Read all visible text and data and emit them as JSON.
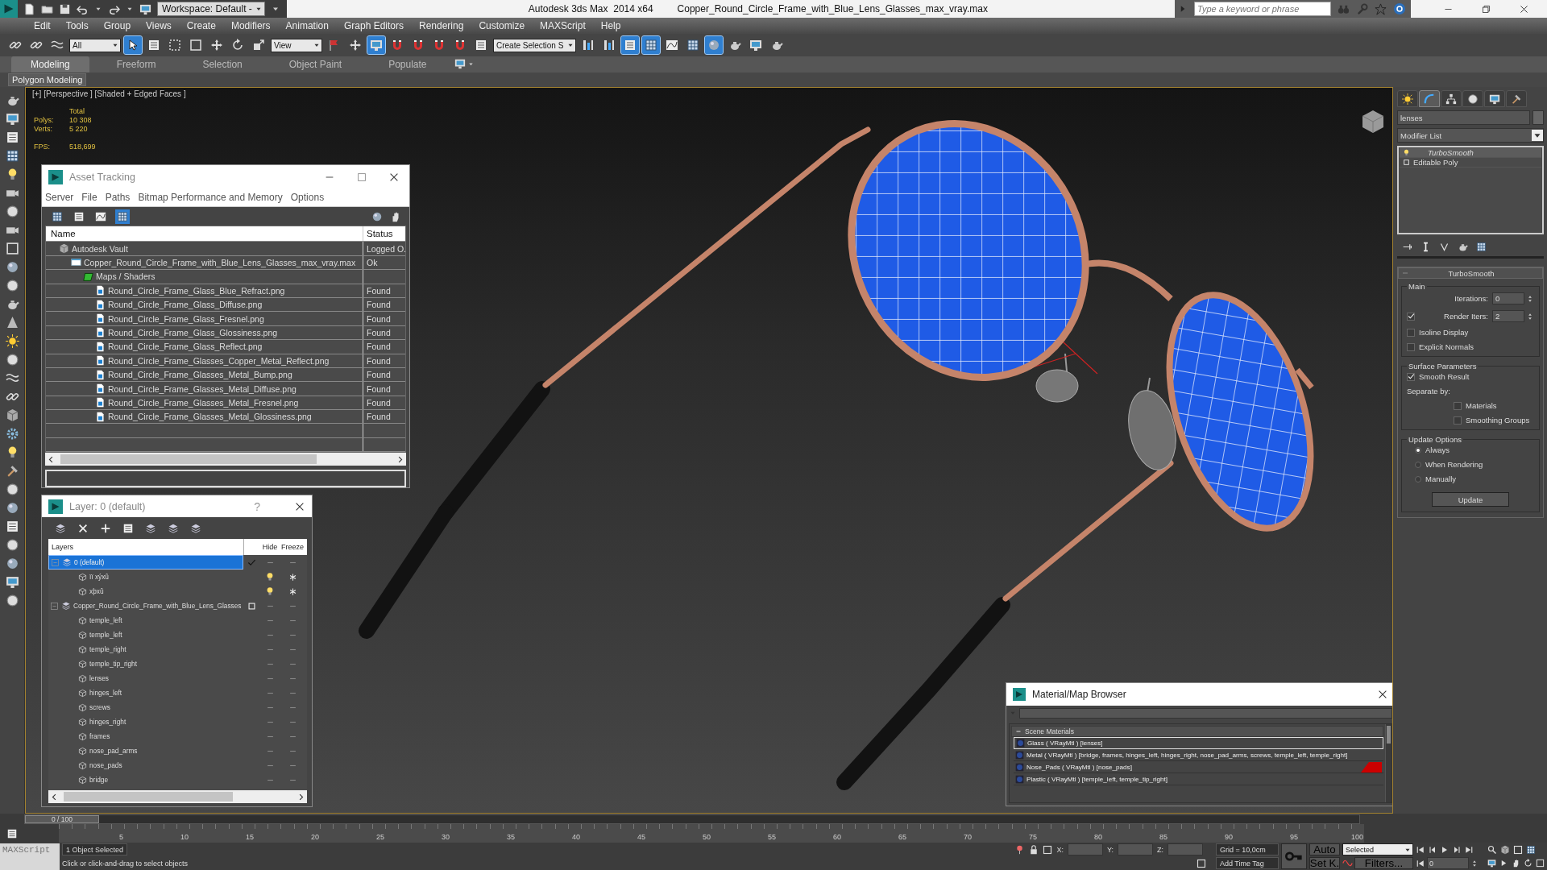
{
  "title_bar": {
    "workspace": "Workspace: Default -",
    "app_title": "Autodesk 3ds Max  2014 x64",
    "file_name": "Copper_Round_Circle_Frame_with_Blue_Lens_Glasses_max_vray.max",
    "search": {
      "placeholder": "Type a keyword or phrase"
    }
  },
  "menu": [
    "Edit",
    "Tools",
    "Group",
    "Views",
    "Create",
    "Modifiers",
    "Animation",
    "Graph Editors",
    "Rendering",
    "Customize",
    "MAXScript",
    "Help"
  ],
  "main_toolbar": [
    {
      "kind": "icon",
      "selected": false
    },
    {
      "kind": "icon",
      "selected": false
    },
    {
      "kind": "icon",
      "selected": false
    },
    {
      "kind": "dropdown",
      "value": "All"
    },
    {
      "kind": "icon",
      "selected": true
    },
    {
      "kind": "icon",
      "selected": false
    },
    {
      "kind": "icon",
      "selected": false
    },
    {
      "kind": "icon",
      "selected": false
    },
    {
      "kind": "icon",
      "selected": false
    },
    {
      "kind": "icon",
      "selected": false
    },
    {
      "kind": "icon",
      "selected": false
    },
    {
      "kind": "dropdown",
      "value": "View"
    },
    {
      "kind": "icon",
      "selected": false
    },
    {
      "kind": "icon",
      "selected": false
    },
    {
      "kind": "icon",
      "selected": true
    },
    {
      "kind": "icon",
      "selected": false
    },
    {
      "kind": "icon",
      "selected": false
    },
    {
      "kind": "icon",
      "selected": false
    },
    {
      "kind": "icon",
      "selected": false
    },
    {
      "kind": "icon",
      "selected": false
    },
    {
      "kind": "dropdown",
      "value": "Create Selection S"
    },
    {
      "kind": "icon",
      "selected": false
    },
    {
      "kind": "icon",
      "selected": false
    },
    {
      "kind": "icon",
      "selected": true
    },
    {
      "kind": "icon",
      "selected": true
    },
    {
      "kind": "icon",
      "selected": false
    },
    {
      "kind": "icon",
      "selected": false
    },
    {
      "kind": "icon",
      "selected": true
    },
    {
      "kind": "icon",
      "selected": false
    },
    {
      "kind": "icon",
      "selected": false
    },
    {
      "kind": "icon",
      "selected": false
    }
  ],
  "ribbon": {
    "tabs": [
      {
        "label": "Modeling",
        "selected": true
      },
      {
        "label": "Freeform",
        "selected": false
      },
      {
        "label": "Selection",
        "selected": false
      },
      {
        "label": "Object Paint",
        "selected": false
      },
      {
        "label": "Populate",
        "selected": false
      }
    ],
    "panel": "Polygon Modeling"
  },
  "viewport": {
    "label": "[+] [Perspective ] [Shaded + Edged Faces ]",
    "stats": {
      "heading": "Total",
      "rows": [
        {
          "label": "Polys:",
          "value": "10 308"
        },
        {
          "label": "Verts:",
          "value": "5 220"
        }
      ]
    },
    "fps": {
      "label": "FPS:",
      "value": "518,699"
    }
  },
  "asset_tracking": {
    "title": "Asset Tracking",
    "menu": [
      "Server",
      "File",
      "Paths",
      "Bitmap Performance and Memory",
      "Options"
    ],
    "toolbar": [
      {
        "selected": false
      },
      {
        "selected": false
      },
      {
        "selected": false
      },
      {
        "selected": true
      }
    ],
    "columns": [
      "Name",
      "Status"
    ],
    "rows": [
      {
        "name": "Autodesk Vault",
        "kind": "vault",
        "status": "Logged O.",
        "children": [
          {
            "name": "Copper_Round_Circle_Frame_with_Blue_Lens_Glasses_max_vray.max",
            "kind": "scene",
            "status": "Ok",
            "children": [
              {
                "name": "Maps / Shaders",
                "kind": "folder",
                "children": [
                  {
                    "name": "Round_Circle_Frame_Glass_Blue_Refract.png",
                    "kind": "bitmap",
                    "status": "Found"
                  },
                  {
                    "name": "Round_Circle_Frame_Glass_Diffuse.png",
                    "kind": "bitmap",
                    "status": "Found"
                  },
                  {
                    "name": "Round_Circle_Frame_Glass_Fresnel.png",
                    "kind": "bitmap",
                    "status": "Found"
                  },
                  {
                    "name": "Round_Circle_Frame_Glass_Glossiness.png",
                    "kind": "bitmap",
                    "status": "Found"
                  },
                  {
                    "name": "Round_Circle_Frame_Glass_Reflect.png",
                    "kind": "bitmap",
                    "status": "Found"
                  },
                  {
                    "name": "Round_Circle_Frame_Glasses_Copper_Metal_Reflect.png",
                    "kind": "bitmap",
                    "status": "Found"
                  },
                  {
                    "name": "Round_Circle_Frame_Glasses_Metal_Bump.png",
                    "kind": "bitmap",
                    "status": "Found"
                  },
                  {
                    "name": "Round_Circle_Frame_Glasses_Metal_Diffuse.png",
                    "kind": "bitmap",
                    "status": "Found"
                  },
                  {
                    "name": "Round_Circle_Frame_Glasses_Metal_Fresnel.png",
                    "kind": "bitmap",
                    "status": "Found"
                  },
                  {
                    "name": "Round_Circle_Frame_Glasses_Metal_Glossiness.png",
                    "kind": "bitmap",
                    "status": "Found"
                  }
                ]
              }
            ]
          }
        ]
      }
    ]
  },
  "layer_window": {
    "title": "Layer: 0 (default)",
    "help": "?",
    "columns": [
      "Layers",
      "Hide",
      "Freeze"
    ],
    "layers": [
      {
        "name": "0 (default)",
        "kind": "layer",
        "selected": true,
        "current": true,
        "expanded": true,
        "show_icons": false,
        "children": [
          {
            "name": "ïï xýxû",
            "kind": "object",
            "selected": false,
            "show_icons": true
          },
          {
            "name": "xþxû",
            "kind": "object",
            "selected": false,
            "show_icons": true
          }
        ]
      },
      {
        "name": "Copper_Round_Circle_Frame_with_Blue_Lens_Glasses",
        "kind": "layer",
        "selected": false,
        "current": false,
        "expanded": true,
        "show_icons": false,
        "children": [
          {
            "name": "temple_left",
            "kind": "object",
            "selected": false,
            "show_icons": false
          },
          {
            "name": "temple_left",
            "kind": "object",
            "selected": false,
            "show_icons": false
          },
          {
            "name": "temple_right",
            "kind": "object",
            "selected": false,
            "show_icons": false
          },
          {
            "name": "temple_tip_right",
            "kind": "object",
            "selected": false,
            "show_icons": false
          },
          {
            "name": "lenses",
            "kind": "object",
            "selected": false,
            "show_icons": false
          },
          {
            "name": "hinges_left",
            "kind": "object",
            "selected": false,
            "show_icons": false
          },
          {
            "name": "screws",
            "kind": "object",
            "selected": false,
            "show_icons": false
          },
          {
            "name": "hinges_right",
            "kind": "object",
            "selected": false,
            "show_icons": false
          },
          {
            "name": "frames",
            "kind": "object",
            "selected": false,
            "show_icons": false
          },
          {
            "name": "nose_pad_arms",
            "kind": "object",
            "selected": false,
            "show_icons": false
          },
          {
            "name": "nose_pads",
            "kind": "object",
            "selected": false,
            "show_icons": false
          },
          {
            "name": "bridge",
            "kind": "object",
            "selected": false,
            "show_icons": false
          }
        ]
      }
    ]
  },
  "material_browser": {
    "title": "Material/Map Browser",
    "group": {
      "label": "Scene Materials",
      "expanded": true
    },
    "items": [
      {
        "label": "Glass ( VRayMtl ) [lenses]",
        "selected": true,
        "marked": false
      },
      {
        "label": "Metal ( VRayMtl ) [bridge, frames, hinges_left, hinges_right, nose_pad_arms, screws, temple_left, temple_right]",
        "selected": false,
        "marked": false
      },
      {
        "label": "Nose_Pads ( VRayMtl ) [nose_pads]",
        "selected": false,
        "marked": true
      },
      {
        "label": "Plastic ( VRayMtl ) [temple_left, temple_tip_right]",
        "selected": false,
        "marked": false
      }
    ]
  },
  "command_panel": {
    "tabs": [
      {
        "selected": false
      },
      {
        "selected": true
      },
      {
        "selected": false
      },
      {
        "selected": false
      },
      {
        "selected": false
      },
      {
        "selected": false
      }
    ],
    "object_name": "lenses",
    "modifier_list": "Modifier List",
    "stack": [
      {
        "label": "TurboSmooth",
        "selected": true,
        "active_in_viewport": false
      },
      {
        "label": "Editable Poly",
        "selected": false,
        "active_in_viewport": true
      }
    ],
    "rollout": {
      "title": "TurboSmooth",
      "expanded": true,
      "groups": [
        {
          "label": "Main",
          "controls": [
            {
              "kind": "spinner",
              "label": "Iterations:",
              "value": "0"
            },
            {
              "kind": "check_spinner",
              "label": "Render Iters:",
              "value": "2",
              "checked": true
            },
            {
              "kind": "checkbox",
              "label": "Isoline Display",
              "checked": false
            },
            {
              "kind": "checkbox",
              "label": "Explicit Normals",
              "checked": false
            }
          ]
        },
        {
          "label": "Surface Parameters",
          "controls": [
            {
              "kind": "checkbox",
              "label": "Smooth Result",
              "checked": true
            },
            {
              "kind": "text",
              "label": "Separate by:",
              "children": [
                {
                  "kind": "checkbox",
                  "label": "Materials",
                  "checked": false
                },
                {
                  "kind": "checkbox",
                  "label": "Smoothing Groups",
                  "checked": false
                }
              ]
            }
          ]
        },
        {
          "label": "Update Options",
          "controls": [
            {
              "kind": "radio",
              "label": "Always",
              "selected": true
            },
            {
              "kind": "radio",
              "label": "When Rendering",
              "selected": false
            },
            {
              "kind": "radio",
              "label": "Manually",
              "selected": false
            },
            {
              "kind": "button",
              "label": "Update"
            }
          ]
        }
      ]
    }
  },
  "timeline": {
    "slider": "0 / 100",
    "level": 0,
    "ticks": [
      "5",
      "10",
      "15",
      "20",
      "25",
      "30",
      "35",
      "40",
      "45",
      "50",
      "55",
      "60",
      "65",
      "70",
      "75",
      "80",
      "85",
      "90",
      "95",
      "100"
    ]
  },
  "status_bar": {
    "maxscript": "MAXScript",
    "selection": "1 Object Selected",
    "prompt": "Click or click-and-drag to select objects",
    "x_label": "X:",
    "y_label": "Y:",
    "z_label": "Z:",
    "grid": "Grid = 10,0cm",
    "add_time_tag": "Add Time Tag",
    "auto": "Auto",
    "set_key": "Set K.",
    "key_filter": "Selected",
    "filters": "Filters...",
    "frame": "0"
  }
}
